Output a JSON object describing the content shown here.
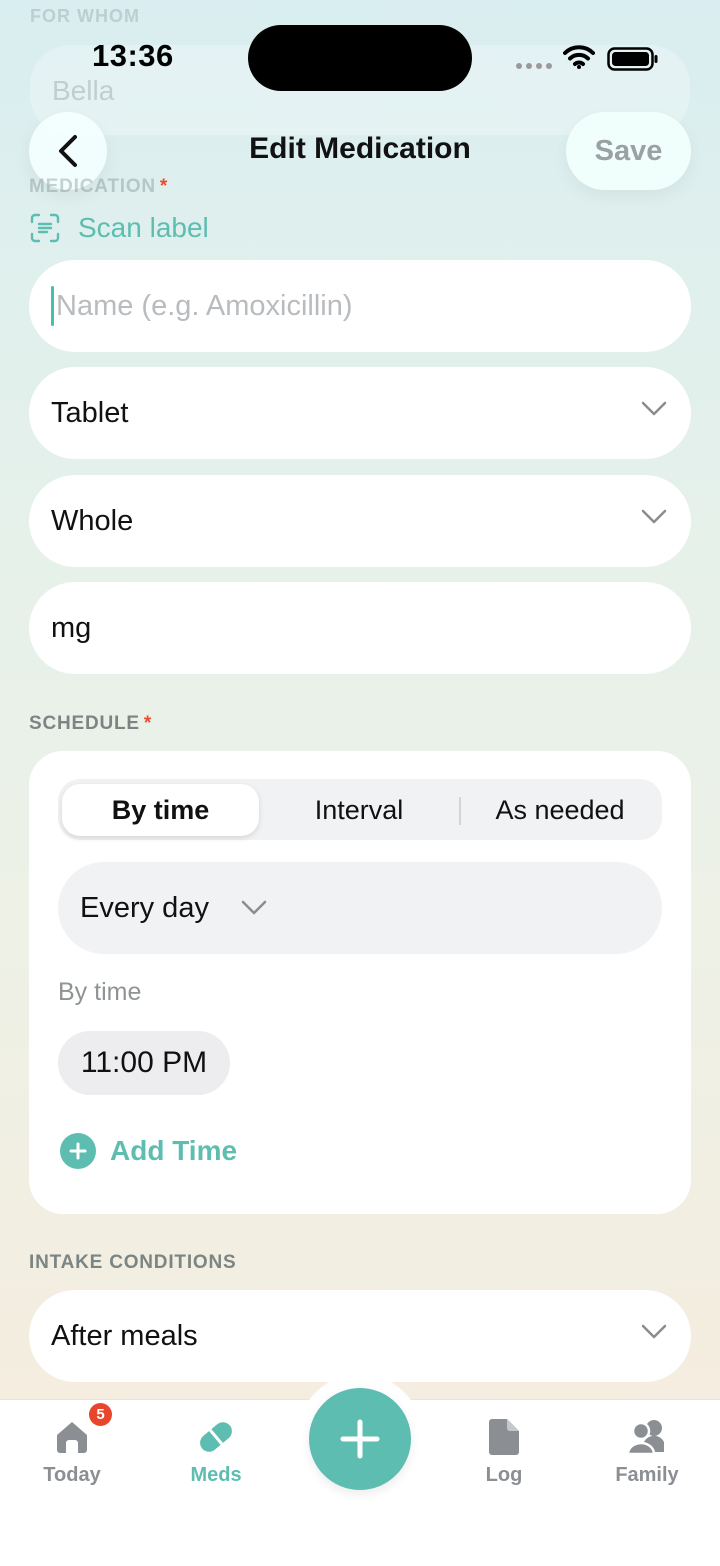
{
  "status_bar": {
    "time": "13:36"
  },
  "ghost": {
    "label": "FOR WHOM",
    "value": "Bella"
  },
  "header": {
    "title": "Edit Medication",
    "save_label": "Save"
  },
  "medication": {
    "label": "MEDICATION",
    "required_mark": "*",
    "scan_label": "Scan label",
    "name_placeholder": "Name (e.g. Amoxicillin)",
    "form_value": "Tablet",
    "portion_value": "Whole",
    "unit_value": "mg"
  },
  "schedule": {
    "label": "SCHEDULE",
    "required_mark": "*",
    "tabs": [
      "By time",
      "Interval",
      "As needed"
    ],
    "selected_tab": "By time",
    "frequency": "Every day",
    "times_label": "By time",
    "times": [
      "11:00 PM"
    ],
    "add_time_label": "Add Time"
  },
  "intake": {
    "label": "INTAKE CONDITIONS",
    "value": "After meals"
  },
  "tabbar": {
    "items": [
      {
        "label": "Today",
        "badge": "5"
      },
      {
        "label": "Meds"
      },
      {
        "label": "Log"
      },
      {
        "label": "Family"
      }
    ],
    "active": "Meds"
  },
  "colors": {
    "accent": "#5dbdb1",
    "required": "#ea4c2c",
    "badge": "#e8452a"
  }
}
